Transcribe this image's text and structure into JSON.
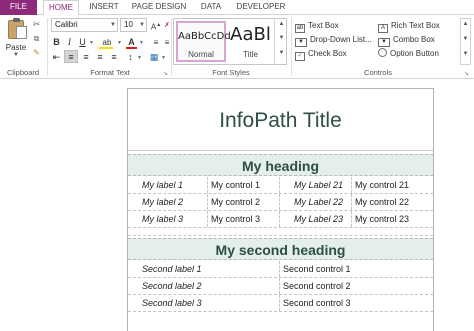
{
  "ribbon": {
    "tabs": [
      "FILE",
      "HOME",
      "INSERT",
      "PAGE DESIGN",
      "DATA",
      "DEVELOPER"
    ],
    "active_tab": "HOME",
    "clipboard": {
      "paste_label": "Paste",
      "group_label": "Clipboard"
    },
    "format_text": {
      "font_name": "Calibri",
      "font_size": "10",
      "group_label": "Format Text"
    },
    "font_styles": {
      "normal_sample": "AaBbCcDd",
      "normal_label": "Normal",
      "title_sample": "AaBl",
      "title_label": "Title",
      "group_label": "Font Styles"
    },
    "controls": {
      "items": [
        "Text Box",
        "Rich Text Box",
        "Drop-Down List...",
        "Combo Box",
        "Check Box",
        "Option Button"
      ],
      "group_label": "Controls"
    }
  },
  "form": {
    "title": "InfoPath Title",
    "section1": {
      "heading": "My heading",
      "rows": [
        [
          "My label 1",
          "My control 1",
          "My Label 21",
          "My control 21"
        ],
        [
          "My label 2",
          "My control 2",
          "My Label 22",
          "My control 22"
        ],
        [
          "My label 3",
          "My control 3",
          "My Label 23",
          "My control 23"
        ]
      ]
    },
    "section2": {
      "heading": "My second heading",
      "rows": [
        [
          "Second label 1",
          "Second control 1"
        ],
        [
          "Second label 2",
          "Second control 2"
        ],
        [
          "Second label 3",
          "Second control 3"
        ]
      ]
    }
  },
  "colors": {
    "file_tab": "#8f2a7a",
    "heading_text": "#2d4f45",
    "heading_fill": "#e4eeea"
  }
}
